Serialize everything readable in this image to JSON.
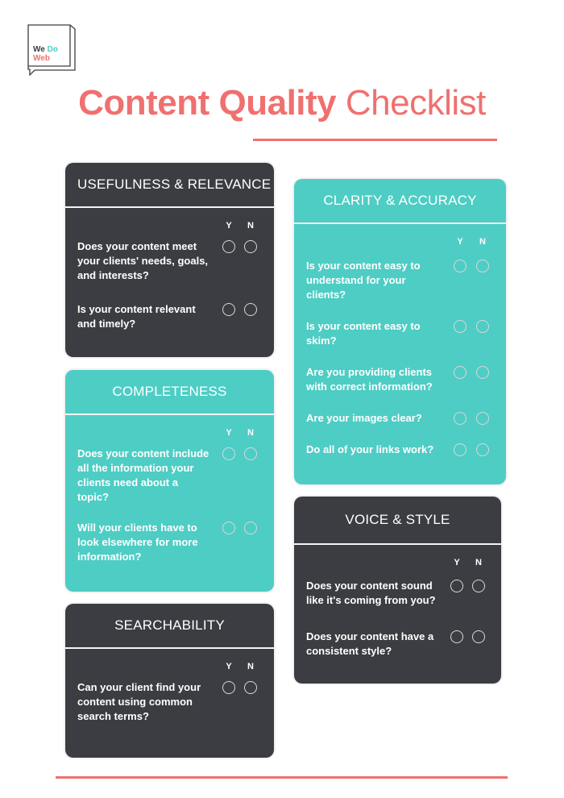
{
  "logo": {
    "line1_part1": "We",
    "line1_part2": "Do",
    "line2": "Web"
  },
  "title": {
    "bold": "Content Quality",
    "regular": "Checklist"
  },
  "colors": {
    "coral": "#f07070",
    "teal": "#4ecdc4",
    "dark": "#3b3d42"
  },
  "yn": {
    "yes": "Y",
    "no": "N"
  },
  "sections": {
    "usefulness": {
      "title": "USEFULNESS & RELEVANCE",
      "questions": [
        "Does your content meet your clients' needs, goals, and interests?",
        "Is your content relevant and timely?"
      ]
    },
    "completeness": {
      "title": "COMPLETENESS",
      "questions": [
        "Does your content include all the information your clients need about a topic?",
        "Will your clients have to look elsewhere for more information?"
      ]
    },
    "searchability": {
      "title": "SEARCHABILITY",
      "questions": [
        "Can your client find your content using common search terms?"
      ]
    },
    "clarity": {
      "title": "CLARITY & ACCURACY",
      "questions": [
        "Is your content easy to understand for your clients?",
        "Is your content easy to skim?",
        "Are you providing clients with correct information?",
        "Are your images clear?",
        "Do all of your links work?"
      ]
    },
    "voice": {
      "title": "VOICE & STYLE",
      "questions": [
        "Does your content sound like it's coming from you?",
        "Does your content have a consistent style?"
      ]
    }
  }
}
